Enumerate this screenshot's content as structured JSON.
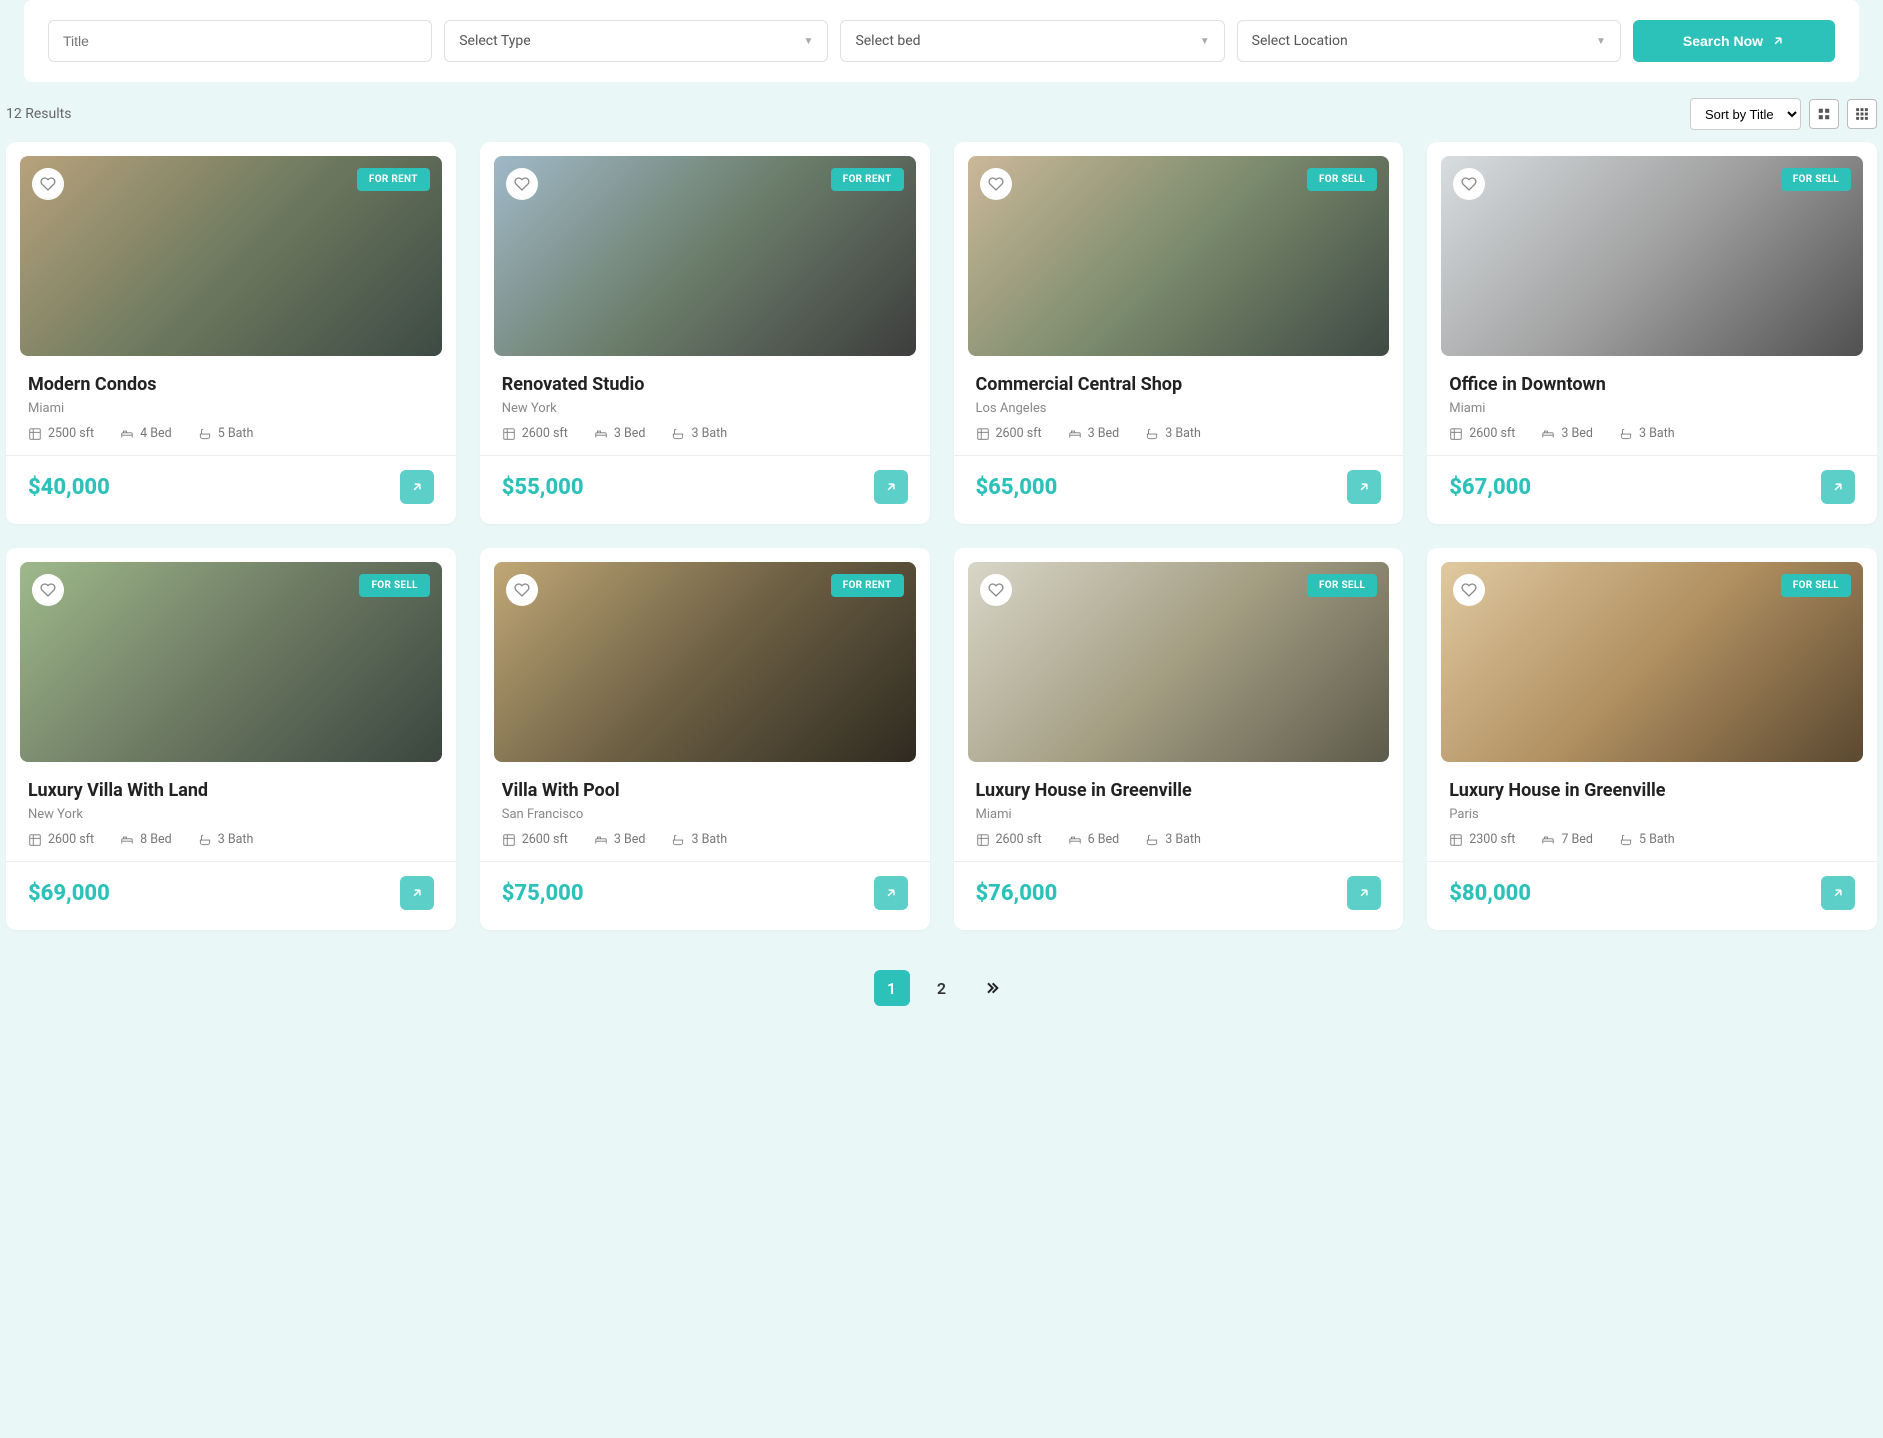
{
  "search": {
    "title_placeholder": "Title",
    "type_placeholder": "Select Type",
    "bed_placeholder": "Select bed",
    "location_placeholder": "Select Location",
    "button": "Search Now"
  },
  "results_count": "12 Results",
  "sort_label": "Sort by Title",
  "listings": [
    {
      "title": "Modern Condos",
      "location": "Miami",
      "sqft": "2500 sft",
      "bed": "4 Bed",
      "bath": "5 Bath",
      "price": "$40,000",
      "tag": "FOR RENT",
      "img": "g1"
    },
    {
      "title": "Renovated Studio",
      "location": "New York",
      "sqft": "2600 sft",
      "bed": "3 Bed",
      "bath": "3 Bath",
      "price": "$55,000",
      "tag": "FOR RENT",
      "img": "g2"
    },
    {
      "title": "Commercial Central Shop",
      "location": "Los Angeles",
      "sqft": "2600 sft",
      "bed": "3 Bed",
      "bath": "3 Bath",
      "price": "$65,000",
      "tag": "FOR SELL",
      "img": "g3"
    },
    {
      "title": "Office in Downtown",
      "location": "Miami",
      "sqft": "2600 sft",
      "bed": "3 Bed",
      "bath": "3 Bath",
      "price": "$67,000",
      "tag": "FOR SELL",
      "img": "g4"
    },
    {
      "title": "Luxury Villa With Land",
      "location": "New York",
      "sqft": "2600 sft",
      "bed": "8 Bed",
      "bath": "3 Bath",
      "price": "$69,000",
      "tag": "FOR SELL",
      "img": "g5"
    },
    {
      "title": "Villa With Pool",
      "location": "San Francisco",
      "sqft": "2600 sft",
      "bed": "3 Bed",
      "bath": "3 Bath",
      "price": "$75,000",
      "tag": "FOR RENT",
      "img": "g6"
    },
    {
      "title": "Luxury House in Greenville",
      "location": "Miami",
      "sqft": "2600 sft",
      "bed": "6 Bed",
      "bath": "3 Bath",
      "price": "$76,000",
      "tag": "FOR SELL",
      "img": "g7"
    },
    {
      "title": "Luxury House in Greenville",
      "location": "Paris",
      "sqft": "2300 sft",
      "bed": "7 Bed",
      "bath": "5 Bath",
      "price": "$80,000",
      "tag": "FOR SELL",
      "img": "g8"
    }
  ],
  "pagination": {
    "page1": "1",
    "page2": "2"
  }
}
